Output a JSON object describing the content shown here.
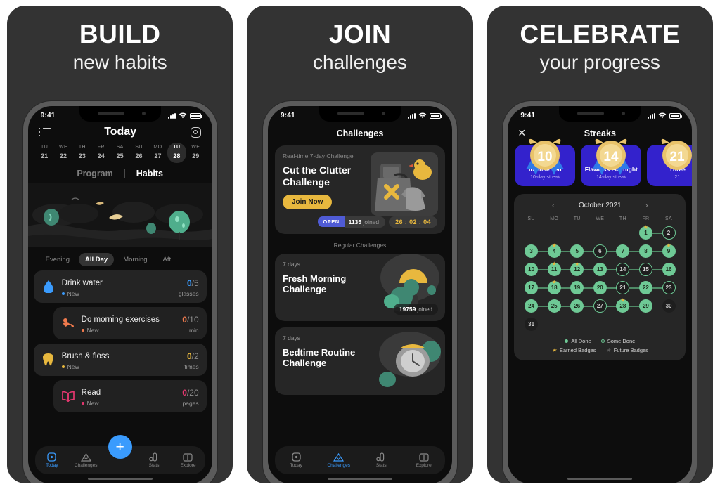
{
  "panels": [
    {
      "headline_top": "BUILD",
      "headline_bottom": "new habits"
    },
    {
      "headline_top": "JOIN",
      "headline_bottom": "challenges"
    },
    {
      "headline_top": "CELEBRATE",
      "headline_bottom": "your progress"
    }
  ],
  "status": {
    "time": "9:41"
  },
  "phone1": {
    "title": "Today",
    "menu_icon": "list-icon",
    "settings_icon": "gear-icon",
    "dates": [
      {
        "dow": "TU",
        "num": "21",
        "selected": false
      },
      {
        "dow": "WE",
        "num": "22",
        "selected": false
      },
      {
        "dow": "TH",
        "num": "23",
        "selected": false
      },
      {
        "dow": "FR",
        "num": "24",
        "selected": false
      },
      {
        "dow": "SA",
        "num": "25",
        "selected": false
      },
      {
        "dow": "SU",
        "num": "26",
        "selected": false
      },
      {
        "dow": "MO",
        "num": "27",
        "selected": false
      },
      {
        "dow": "TU",
        "num": "28",
        "selected": true
      },
      {
        "dow": "WE",
        "num": "29",
        "selected": false
      }
    ],
    "segments": [
      {
        "label": "Program",
        "active": false
      },
      {
        "label": "Habits",
        "active": true
      }
    ],
    "filters": [
      {
        "label": "Evening",
        "active": false
      },
      {
        "label": "All Day",
        "active": true
      },
      {
        "label": "Morning",
        "active": false
      },
      {
        "label": "Aft",
        "active": false
      }
    ],
    "habits": [
      {
        "name": "Drink water",
        "sub": "New",
        "count": "0",
        "total": "/5",
        "unit": "glasses",
        "color": "#3a9bfd",
        "icon": "water-drop-icon",
        "indent": false
      },
      {
        "name": "Do morning exercises",
        "sub": "New",
        "count": "0",
        "total": "/10",
        "unit": "min",
        "color": "#f07a4d",
        "icon": "exercise-icon",
        "indent": true
      },
      {
        "name": "Brush & floss",
        "sub": "New",
        "count": "0",
        "total": "/2",
        "unit": "times",
        "color": "#e8b83e",
        "icon": "tooth-icon",
        "indent": false
      },
      {
        "name": "Read",
        "sub": "New",
        "count": "0",
        "total": "/20",
        "unit": "pages",
        "color": "#e5376f",
        "icon": "book-icon",
        "indent": true
      }
    ],
    "fab_label": "+",
    "tabs": [
      {
        "label": "Today",
        "icon": "today-icon",
        "active": true
      },
      {
        "label": "Challenges",
        "icon": "mountain-icon",
        "active": false
      },
      {
        "label": "Stats",
        "icon": "stats-icon",
        "active": false
      },
      {
        "label": "Explore",
        "icon": "book-open-icon",
        "active": false
      }
    ]
  },
  "phone2": {
    "title": "Challenges",
    "featured": {
      "kicker": "Real-time 7-day Challenge",
      "title": "Cut the Clutter Challenge",
      "button": "Join Now",
      "status_pill": "OPEN",
      "joined_count": "1135",
      "joined_label": "joined",
      "timer": "26 : 02 : 04",
      "art": "declutter-bag-duck-illustration"
    },
    "section_title": "Regular Challenges",
    "regular": [
      {
        "days": "7 days",
        "title": "Fresh Morning Challenge",
        "joined_count": "19759",
        "joined_label": "joined",
        "art": "sunrise-trees-illustration"
      },
      {
        "days": "7 days",
        "title": "Bedtime Routine Challenge",
        "joined_count": "",
        "joined_label": "",
        "art": "alarm-clock-illustration"
      }
    ],
    "tabs": [
      {
        "label": "Today",
        "icon": "today-icon",
        "active": false
      },
      {
        "label": "Challenges",
        "icon": "mountain-icon",
        "active": true
      },
      {
        "label": "Stats",
        "icon": "stats-icon",
        "active": false
      },
      {
        "label": "Explore",
        "icon": "book-open-icon",
        "active": false
      }
    ]
  },
  "phone3": {
    "title": "Streaks",
    "close_icon": "close-icon",
    "badges": [
      {
        "number": "10",
        "name": "Intense Ten",
        "sub": "10-day streak"
      },
      {
        "number": "14",
        "name": "Flawless Fortnight",
        "sub": "14-day streak"
      },
      {
        "number": "21",
        "name": "Three",
        "sub": "21"
      }
    ],
    "calendar": {
      "month": "October 2021",
      "prev_icon": "chevron-left-icon",
      "next_icon": "chevron-right-icon",
      "dow": [
        "SU",
        "MO",
        "TU",
        "WE",
        "TH",
        "FR",
        "SA"
      ],
      "lead_blanks": 5,
      "days": [
        {
          "n": "1",
          "state": "all",
          "star": true,
          "link": true
        },
        {
          "n": "2",
          "state": "some",
          "star": false,
          "link": true
        },
        {
          "n": "3",
          "state": "all",
          "star": false,
          "link": true
        },
        {
          "n": "4",
          "state": "all",
          "star": true,
          "link": true
        },
        {
          "n": "5",
          "state": "all",
          "star": false,
          "link": true
        },
        {
          "n": "6",
          "state": "some",
          "star": false,
          "link": true
        },
        {
          "n": "7",
          "state": "all",
          "star": false,
          "link": true
        },
        {
          "n": "8",
          "state": "all",
          "star": false,
          "link": true
        },
        {
          "n": "9",
          "state": "all",
          "star": true,
          "link": true
        },
        {
          "n": "10",
          "state": "all",
          "star": false,
          "link": true
        },
        {
          "n": "11",
          "state": "all",
          "star": true,
          "link": true
        },
        {
          "n": "12",
          "state": "all",
          "star": true,
          "link": true
        },
        {
          "n": "13",
          "state": "all",
          "star": false,
          "link": true
        },
        {
          "n": "14",
          "state": "some",
          "star": false,
          "link": true
        },
        {
          "n": "15",
          "state": "some",
          "star": false,
          "link": true
        },
        {
          "n": "16",
          "state": "all",
          "star": false,
          "link": true
        },
        {
          "n": "17",
          "state": "all",
          "star": false,
          "link": true
        },
        {
          "n": "18",
          "state": "all",
          "star": true,
          "link": true
        },
        {
          "n": "19",
          "state": "all",
          "star": false,
          "link": true
        },
        {
          "n": "20",
          "state": "all",
          "star": false,
          "link": true
        },
        {
          "n": "21",
          "state": "some",
          "star": false,
          "link": true
        },
        {
          "n": "22",
          "state": "all",
          "star": false,
          "link": true
        },
        {
          "n": "23",
          "state": "some",
          "star": false,
          "link": true
        },
        {
          "n": "24",
          "state": "all",
          "star": false,
          "link": true
        },
        {
          "n": "25",
          "state": "all",
          "star": false,
          "link": true
        },
        {
          "n": "26",
          "state": "all",
          "star": false,
          "link": true
        },
        {
          "n": "27",
          "state": "some",
          "star": false,
          "link": true
        },
        {
          "n": "28",
          "state": "all",
          "star": true,
          "link": true
        },
        {
          "n": "29",
          "state": "all",
          "star": false,
          "link": false
        },
        {
          "n": "30",
          "state": "none",
          "star": false,
          "link": false
        },
        {
          "n": "31",
          "state": "none",
          "star": false,
          "link": false
        }
      ],
      "legend": [
        {
          "label": "All Done",
          "kind": "all"
        },
        {
          "label": "Some Done",
          "kind": "some"
        },
        {
          "label": "Earned Badges",
          "kind": "star"
        },
        {
          "label": "Future Badges",
          "kind": "fut"
        }
      ]
    }
  },
  "colors": {
    "page_bg": "#ffffff",
    "panel_bg": "#333333",
    "screen_bg": "#0d0d0d",
    "accent_blue": "#3a9bfd",
    "accent_yellow": "#e8b83e",
    "accent_green": "#6ec995",
    "badge_purple": "#3322cc",
    "pill_indigo": "#4f5bd5"
  }
}
